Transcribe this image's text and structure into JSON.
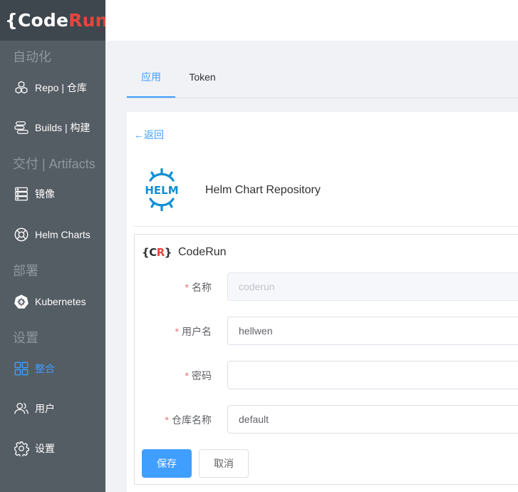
{
  "brand": {
    "open_brace": "{",
    "code": "Code",
    "run": "Run",
    "close_brace": "}",
    "accent_color": "#e8453c"
  },
  "sidebar": {
    "groups": [
      {
        "label": "自动化"
      },
      {
        "label": "交付 | Artifacts"
      },
      {
        "label": "部署"
      },
      {
        "label": "设置"
      }
    ],
    "items": [
      {
        "label": "Repo | 仓库",
        "icon": "cubes-icon",
        "active": false
      },
      {
        "label": "Builds | 构建",
        "icon": "stack-icon",
        "active": false
      },
      {
        "label": "镜像",
        "icon": "server-icon",
        "active": false
      },
      {
        "label": "Helm Charts",
        "icon": "lifebuoy-icon",
        "active": false
      },
      {
        "label": "Kubernetes",
        "icon": "kubernetes-icon",
        "active": false
      },
      {
        "label": "整合",
        "icon": "grid-icon",
        "active": true
      },
      {
        "label": "用户",
        "icon": "users-icon",
        "active": false
      },
      {
        "label": "设置",
        "icon": "gear-icon",
        "active": false
      }
    ]
  },
  "tabs": [
    {
      "label": "应用",
      "active": true
    },
    {
      "label": "Token",
      "active": false
    }
  ],
  "detail": {
    "back_label": "←返回",
    "helm_logo_text": "HELM",
    "title": "Helm Chart Repository"
  },
  "integration": {
    "icon_left": "{",
    "icon_c": "C",
    "icon_r": "R",
    "icon_right": "}",
    "name": "CodeRun"
  },
  "form": {
    "required_mark": "*",
    "fields": [
      {
        "label": "名称",
        "value": "coderun",
        "disabled": true
      },
      {
        "label": "用户名",
        "value": "hellwen",
        "disabled": false
      },
      {
        "label": "密码",
        "value": "",
        "disabled": false
      },
      {
        "label": "仓库名称",
        "value": "default",
        "disabled": false
      }
    ],
    "save_label": "保存",
    "cancel_label": "取消"
  },
  "colors": {
    "sidebar_bg": "#545c64",
    "primary": "#409eff",
    "required": "#f56c6c"
  }
}
